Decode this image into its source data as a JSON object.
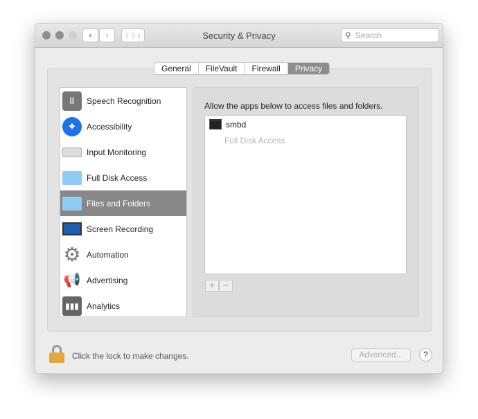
{
  "window": {
    "title": "Security & Privacy",
    "search_placeholder": "Search"
  },
  "tabs": [
    {
      "label": "General"
    },
    {
      "label": "FileVault"
    },
    {
      "label": "Firewall"
    },
    {
      "label": "Privacy"
    }
  ],
  "sidebar": {
    "items": [
      {
        "label": "Speech Recognition"
      },
      {
        "label": "Accessibility"
      },
      {
        "label": "Input Monitoring"
      },
      {
        "label": "Full Disk Access"
      },
      {
        "label": "Files and Folders"
      },
      {
        "label": "Screen Recording"
      },
      {
        "label": "Automation"
      },
      {
        "label": "Advertising"
      },
      {
        "label": "Analytics"
      }
    ]
  },
  "main": {
    "description": "Allow the apps below to access files and folders.",
    "apps": [
      {
        "name": "smbd",
        "sub": "Full Disk Access"
      }
    ],
    "add": "+",
    "remove": "−"
  },
  "footer": {
    "lock_text": "Click the lock to make changes.",
    "advanced": "Advanced...",
    "help": "?"
  }
}
